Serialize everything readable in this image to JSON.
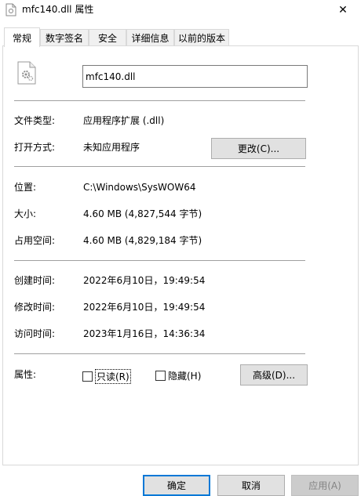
{
  "window": {
    "title": "mfc140.dll 属性",
    "close_glyph": "✕"
  },
  "tabs": [
    {
      "label": "常规",
      "active": true
    },
    {
      "label": "数字签名",
      "active": false
    },
    {
      "label": "安全",
      "active": false
    },
    {
      "label": "详细信息",
      "active": false
    },
    {
      "label": "以前的版本",
      "active": false
    }
  ],
  "general": {
    "file_name": "mfc140.dll",
    "file_type_label": "文件类型:",
    "file_type_value": "应用程序扩展 (.dll)",
    "open_with_label": "打开方式:",
    "open_with_value": "未知应用程序",
    "change_button": "更改(C)...",
    "location_label": "位置:",
    "location_value": "C:\\Windows\\SysWOW64",
    "size_label": "大小:",
    "size_value": "4.60 MB (4,827,544 字节)",
    "size_on_disk_label": "占用空间:",
    "size_on_disk_value": "4.60 MB (4,829,184 字节)",
    "created_label": "创建时间:",
    "created_value": "2022年6月10日，19:49:54",
    "modified_label": "修改时间:",
    "modified_value": "2022年6月10日，19:49:54",
    "accessed_label": "访问时间:",
    "accessed_value": "2023年1月16日，14:36:34",
    "attributes_label": "属性:",
    "readonly_label": "只读(R)",
    "readonly_checked": false,
    "hidden_label": "隐藏(H)",
    "hidden_checked": false,
    "advanced_button": "高级(D)..."
  },
  "footer": {
    "ok": "确定",
    "cancel": "取消",
    "apply": "应用(A)"
  },
  "colors": {
    "accent": "#0078d7",
    "button_bg": "#e1e1e1",
    "disabled_bg": "#cccccc"
  }
}
